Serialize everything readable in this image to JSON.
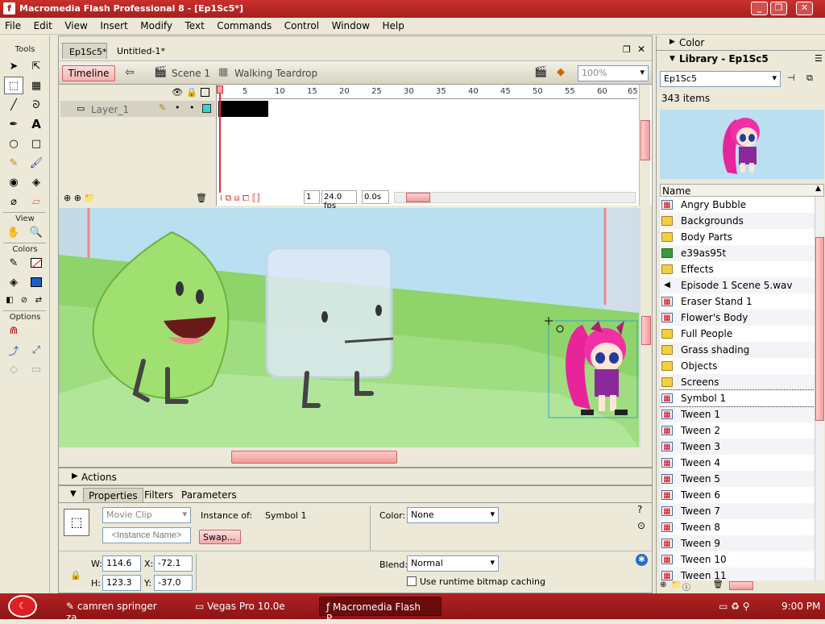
{
  "window": {
    "title": "Macromedia Flash Professional 8 - [Ep1Sc5*]",
    "app_letter": "f"
  },
  "menu": [
    "File",
    "Edit",
    "View",
    "Insert",
    "Modify",
    "Text",
    "Commands",
    "Control",
    "Window",
    "Help"
  ],
  "tools": {
    "tools_label": "Tools",
    "view_label": "View",
    "colors_label": "Colors",
    "options_label": "Options"
  },
  "doc": {
    "tabs": [
      "Ep1Sc5*",
      "Untitled-1*"
    ],
    "timeline_button": "Timeline",
    "scene": "Scene 1",
    "symbol": "Walking Teardrop",
    "zoom": "100%"
  },
  "timeline": {
    "layer": "Layer_1",
    "ruler": [
      "1",
      "5",
      "10",
      "15",
      "20",
      "25",
      "30",
      "35",
      "40",
      "45",
      "50",
      "55",
      "60",
      "65"
    ],
    "frame": "1",
    "fps": "24.0 fps",
    "time": "0.0s"
  },
  "actions": {
    "label": "Actions"
  },
  "props": {
    "tabs": [
      "Properties",
      "Filters",
      "Parameters"
    ],
    "type": "Movie Clip",
    "instance_placeholder": "<Instance Name>",
    "instance_of_label": "Instance of:",
    "instance_of": "Symbol 1",
    "swap": "Swap...",
    "color_label": "Color:",
    "color": "None",
    "w_label": "W:",
    "w": "114.6",
    "h_label": "H:",
    "h": "123.3",
    "x_label": "X:",
    "x": "-72.1",
    "y_label": "Y:",
    "y": "-37.0",
    "blend_label": "Blend:",
    "blend": "Normal",
    "cache_label": "Use runtime bitmap caching"
  },
  "right": {
    "color_panel": "Color",
    "library_panel": "Library - Ep1Sc5",
    "library_select": "Ep1Sc5",
    "count": "343 items",
    "name_col": "Name"
  },
  "library": [
    {
      "name": "Angry Bubble",
      "kind": "sym"
    },
    {
      "name": "Backgrounds",
      "kind": "folder"
    },
    {
      "name": "Body Parts",
      "kind": "folder"
    },
    {
      "name": "e39as95t",
      "kind": "bmp"
    },
    {
      "name": "Effects",
      "kind": "folder"
    },
    {
      "name": "Episode 1 Scene 5.wav",
      "kind": "snd"
    },
    {
      "name": "Eraser Stand 1",
      "kind": "sym"
    },
    {
      "name": "Flower's Body",
      "kind": "sym"
    },
    {
      "name": "Full People",
      "kind": "folder"
    },
    {
      "name": "Grass shading",
      "kind": "folder"
    },
    {
      "name": "Objects",
      "kind": "folder"
    },
    {
      "name": "Screens",
      "kind": "folder"
    },
    {
      "name": "Symbol 1",
      "kind": "sym"
    },
    {
      "name": "Tween 1",
      "kind": "sym"
    },
    {
      "name": "Tween 2",
      "kind": "sym"
    },
    {
      "name": "Tween 3",
      "kind": "sym"
    },
    {
      "name": "Tween 4",
      "kind": "sym"
    },
    {
      "name": "Tween 5",
      "kind": "sym"
    },
    {
      "name": "Tween 6",
      "kind": "sym"
    },
    {
      "name": "Tween 7",
      "kind": "sym"
    },
    {
      "name": "Tween 8",
      "kind": "sym"
    },
    {
      "name": "Tween 9",
      "kind": "sym"
    },
    {
      "name": "Tween 10",
      "kind": "sym"
    },
    {
      "name": "Tween 11",
      "kind": "sym"
    }
  ],
  "taskbar": {
    "items": [
      "camren springer za...",
      "Vegas Pro 10.0e",
      "Macromedia Flash P..."
    ],
    "clock": "9:00 PM"
  },
  "colors": {
    "title_bar": "#b42826",
    "taskbar": "#a01a1a",
    "stage_sky": "#b9dff0",
    "grass": "#8fd46a",
    "accent_pink": "#e8249a"
  }
}
